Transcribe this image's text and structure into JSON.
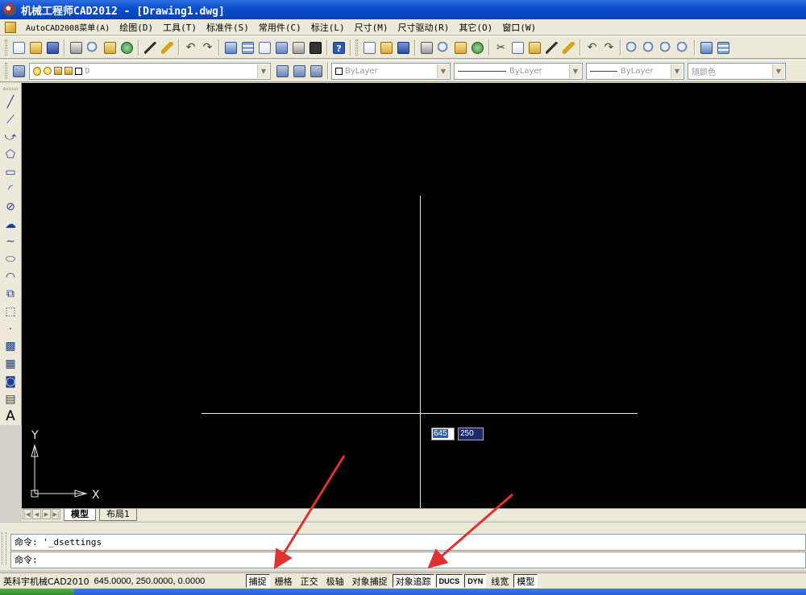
{
  "window": {
    "title": "机械工程师CAD2012 - [Drawing1.dwg]"
  },
  "menu": [
    "AutoCAD2008菜单(A)",
    "绘图(D)",
    "工具(T)",
    "标准件(S)",
    "常用件(C)",
    "标注(L)",
    "尺寸(M)",
    "尺寸驱动(R)",
    "其它(O)",
    "窗口(W)"
  ],
  "properties": {
    "layer_value": "0",
    "color": "ByLayer",
    "linetype": "ByLayer",
    "lineweight": "ByLayer",
    "plotstyle": "随颜色"
  },
  "canvas": {
    "dyn_x": "645",
    "dyn_y": "250",
    "ucs_y": "Y",
    "ucs_x": "X",
    "background": "#000000",
    "crosshair": "#e8e8e8",
    "annotation_arrow": "#e0322f"
  },
  "tabs": [
    "模型",
    "布局1"
  ],
  "command": {
    "line1": "命令: '_dsettings",
    "line2": "命令:"
  },
  "status": {
    "app_name": "英科宇机械CAD2010",
    "coordinates": "645.0000,  250.0000, 0.0000",
    "buttons": [
      {
        "label": "捕捉",
        "on": true
      },
      {
        "label": "栅格",
        "on": false
      },
      {
        "label": "正交",
        "on": false
      },
      {
        "label": "极轴",
        "on": false
      },
      {
        "label": "对象捕捉",
        "on": false
      },
      {
        "label": "对象追踪",
        "on": true
      },
      {
        "label": "DUCS",
        "on": true
      },
      {
        "label": "DYN",
        "on": true
      },
      {
        "label": "线宽",
        "on": false
      },
      {
        "label": "模型",
        "on": true
      }
    ]
  }
}
